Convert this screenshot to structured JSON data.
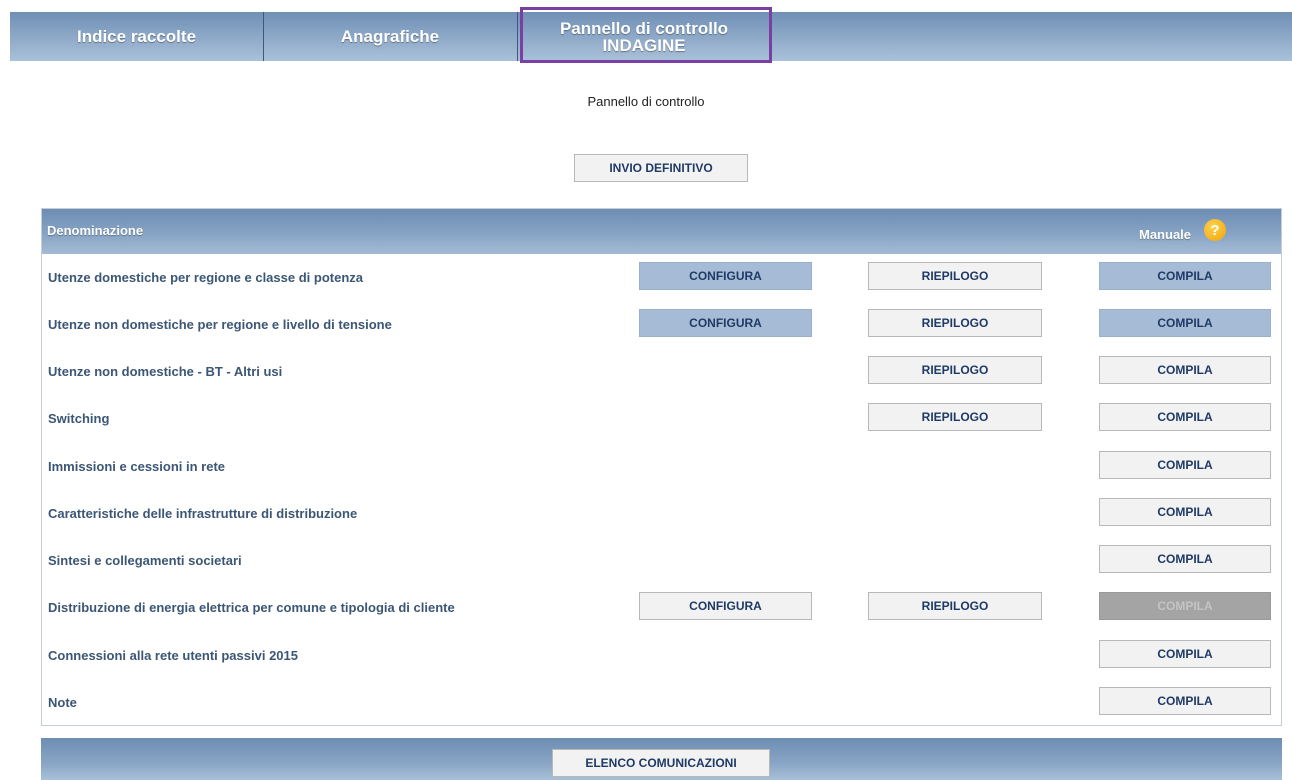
{
  "nav": {
    "tab1": "Indice raccolte",
    "tab2": "Anagrafiche",
    "tab3_line1": "Pannello di controllo",
    "tab3_line2": "INDAGINE"
  },
  "page_subtitle": "Pannello di controllo",
  "submit_button": "INVIO DEFINITIVO",
  "table": {
    "header_name": "Denominazione",
    "header_manual": "Manuale",
    "help_symbol": "?",
    "rows": [
      {
        "label": "Utenze domestiche per regione e classe di potenza",
        "configura": "CONFIGURA",
        "riepilogo": "RIEPILOGO",
        "compila": "COMPILA"
      },
      {
        "label": "Utenze non domestiche per regione e livello di tensione",
        "configura": "CONFIGURA",
        "riepilogo": "RIEPILOGO",
        "compila": "COMPILA"
      },
      {
        "label": "Utenze non domestiche - BT - Altri usi",
        "riepilogo": "RIEPILOGO",
        "compila": "COMPILA"
      },
      {
        "label": "Switching",
        "riepilogo": "RIEPILOGO",
        "compila": "COMPILA"
      },
      {
        "label": "Immissioni e cessioni in rete",
        "compila": "COMPILA"
      },
      {
        "label": "Caratteristiche delle infrastrutture di distribuzione",
        "compila": "COMPILA"
      },
      {
        "label": "Sintesi e collegamenti societari",
        "compila": "COMPILA"
      },
      {
        "label": "Distribuzione di energia elettrica per comune e tipologia di cliente",
        "configura": "CONFIGURA",
        "riepilogo": "RIEPILOGO",
        "compila": "COMPILA"
      },
      {
        "label": "Connessioni alla rete utenti passivi 2015",
        "compila": "COMPILA"
      },
      {
        "label": "Note",
        "compila": "COMPILA"
      }
    ]
  },
  "footer_button": "ELENCO COMUNICAZIONI",
  "colors": {
    "nav_bar": "#8aa6c6",
    "active_tab_border": "#7a3fa3",
    "button_blue": "#a6bcd6",
    "button_disabled": "#a4a4a4",
    "label_text": "#3c5675"
  }
}
